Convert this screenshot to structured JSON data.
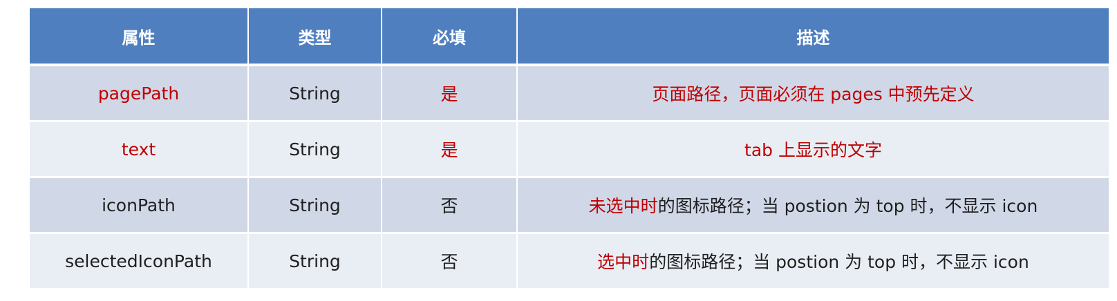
{
  "table": {
    "headers": [
      "属性",
      "类型",
      "必填",
      "描述"
    ],
    "rows": [
      {
        "property": "pagePath",
        "type": "String",
        "required": "是",
        "description_red": "页面路径，页面必须在 pages 中预先定义",
        "description_rest": ""
      },
      {
        "property": "text",
        "type": "String",
        "required": "是",
        "description_red": "tab 上显示的文字",
        "description_rest": ""
      },
      {
        "property": "iconPath",
        "type": "String",
        "required": "否",
        "description_red": "未选中时",
        "description_rest": "的图标路径；当 postion 为 top 时，不显示 icon"
      },
      {
        "property": "selectedIconPath",
        "type": "String",
        "required": "否",
        "description_red": "选中时",
        "description_rest": "的图标路径；当 postion 为 top 时，不显示 icon"
      }
    ]
  },
  "colors": {
    "header_bg": "#4f7fbf",
    "row_odd_bg": "#d0d8e8",
    "row_even_bg": "#e9edf4",
    "highlight_red": "#c00000"
  }
}
